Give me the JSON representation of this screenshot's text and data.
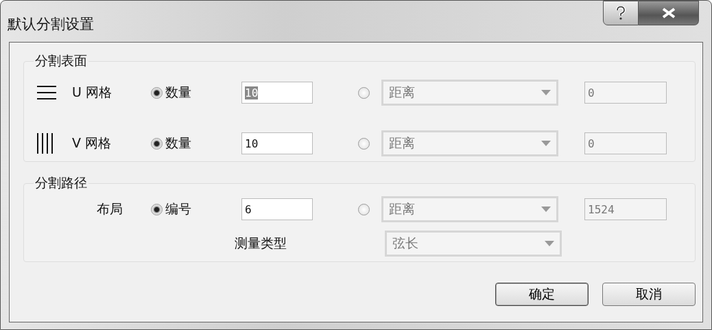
{
  "window": {
    "title": "默认分割设置"
  },
  "surface": {
    "legend": "分割表面",
    "rows": [
      {
        "kind": "u-grid",
        "label": "U 网格",
        "option_a": {
          "label": "数量",
          "selected": true
        },
        "count": {
          "value": "10",
          "text_selected": true
        },
        "option_b": {
          "selected": false
        },
        "dropdown": {
          "value": "距离",
          "disabled": true
        },
        "distance": {
          "value": "0",
          "disabled": true
        }
      },
      {
        "kind": "v-grid",
        "label": "V 网格",
        "option_a": {
          "label": "数量",
          "selected": true
        },
        "count": {
          "value": "10",
          "text_selected": false
        },
        "option_b": {
          "selected": false
        },
        "dropdown": {
          "value": "距离",
          "disabled": true
        },
        "distance": {
          "value": "0",
          "disabled": true
        }
      }
    ]
  },
  "path": {
    "legend": "分割路径",
    "rows": [
      {
        "kind": "plain",
        "label": "布局",
        "option_a": {
          "label": "编号",
          "selected": true
        },
        "count": {
          "value": "6",
          "text_selected": false
        },
        "option_b": {
          "selected": false
        },
        "dropdown": {
          "value": "距离",
          "disabled": true
        },
        "distance": {
          "value": "1524",
          "disabled": true
        }
      }
    ],
    "measure": {
      "label": "测量类型",
      "dropdown": {
        "value": "弦长",
        "disabled": true
      }
    }
  },
  "buttons": [
    {
      "label": "确定",
      "default": true
    },
    {
      "label": "取消",
      "default": false
    }
  ]
}
